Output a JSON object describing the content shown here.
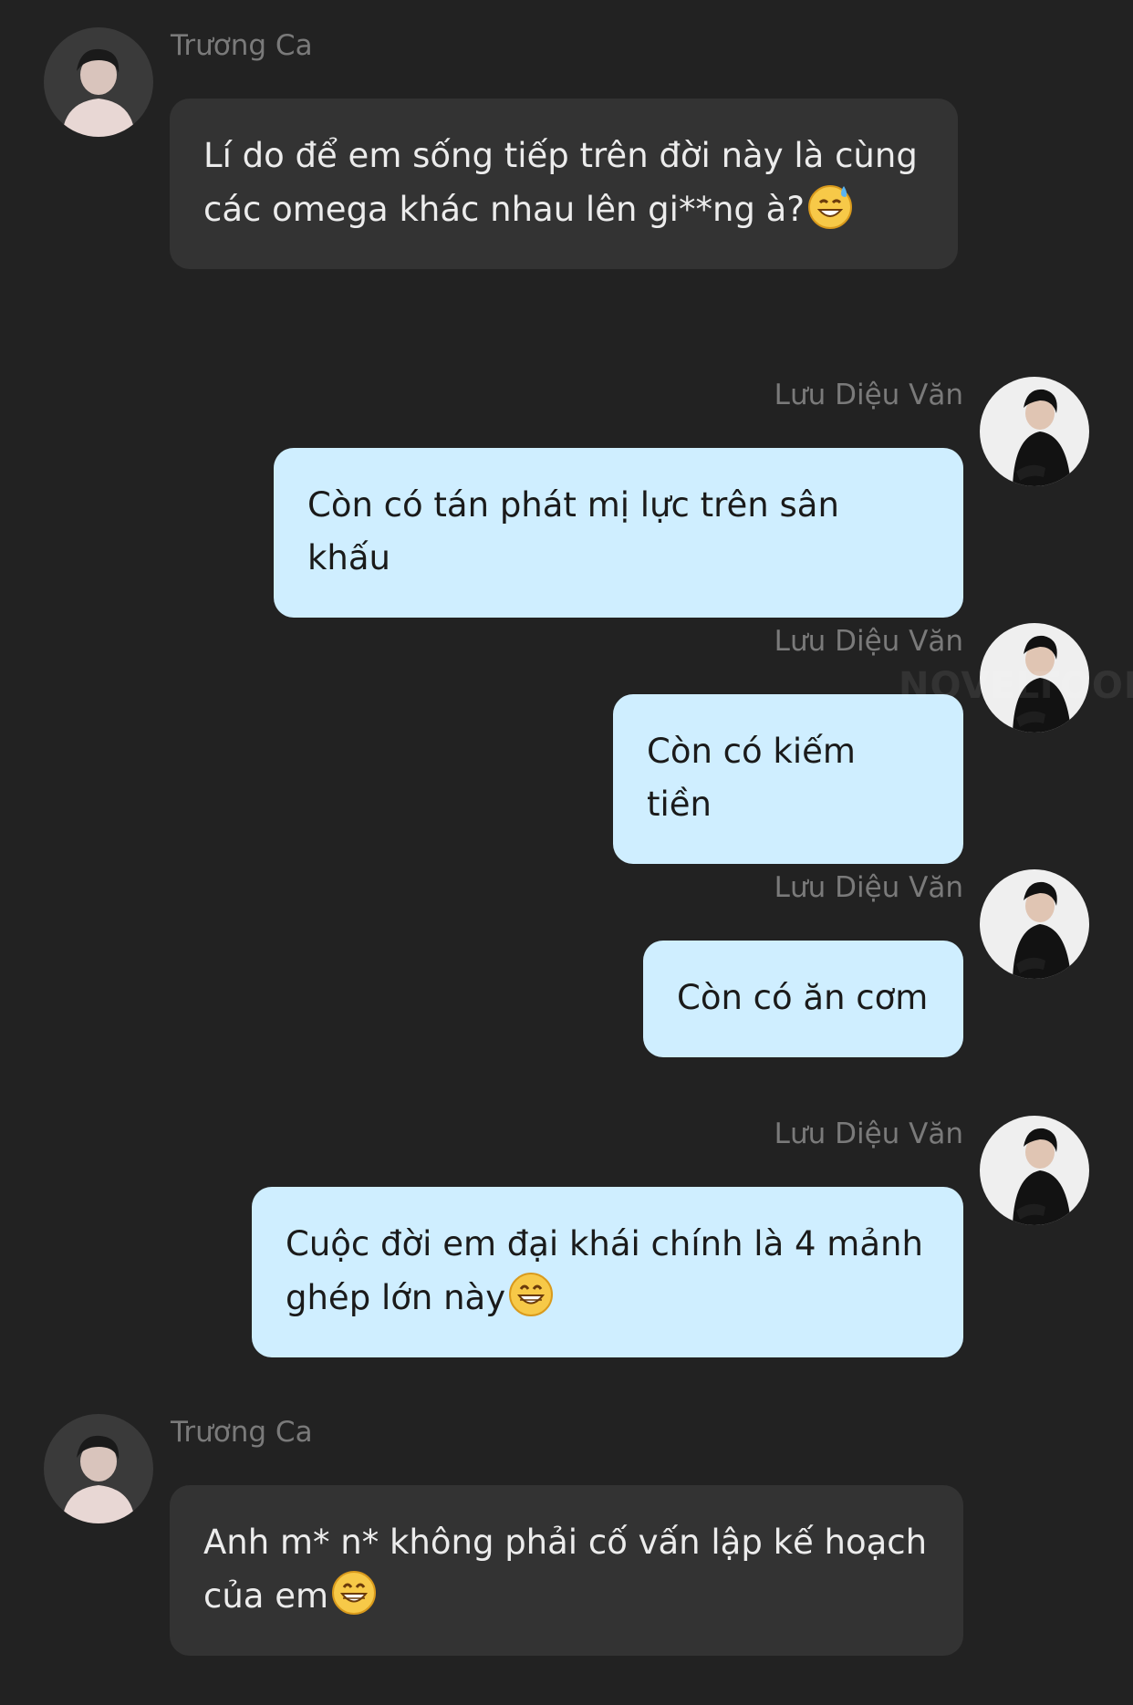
{
  "watermark": "NOVELTOON",
  "messages": [
    {
      "side": "left",
      "sender": "Trương Ca",
      "text": "Lí do để em sống tiếp trên đời này là cùng các omega khác nhau lên gi**ng à?",
      "emoji": "sweat-smile-emoji"
    },
    {
      "side": "right",
      "sender": "Lưu Diệu Văn",
      "text": "Còn có tán phát mị lực trên sân khấu"
    },
    {
      "side": "right",
      "sender": "Lưu Diệu Văn",
      "text": "Còn có kiếm tiền"
    },
    {
      "side": "right",
      "sender": "Lưu Diệu Văn",
      "text": "Còn có ăn cơm"
    },
    {
      "side": "right",
      "sender": "Lưu Diệu Văn",
      "text": "Cuộc đời em đại khái chính là 4 mảnh ghép lớn này",
      "emoji": "grin-emoji"
    },
    {
      "side": "left",
      "sender": "Trương Ca",
      "text": "Anh m* n* không phải cố vấn lập kế hoạch của em",
      "emoji": "grin-emoji"
    }
  ]
}
